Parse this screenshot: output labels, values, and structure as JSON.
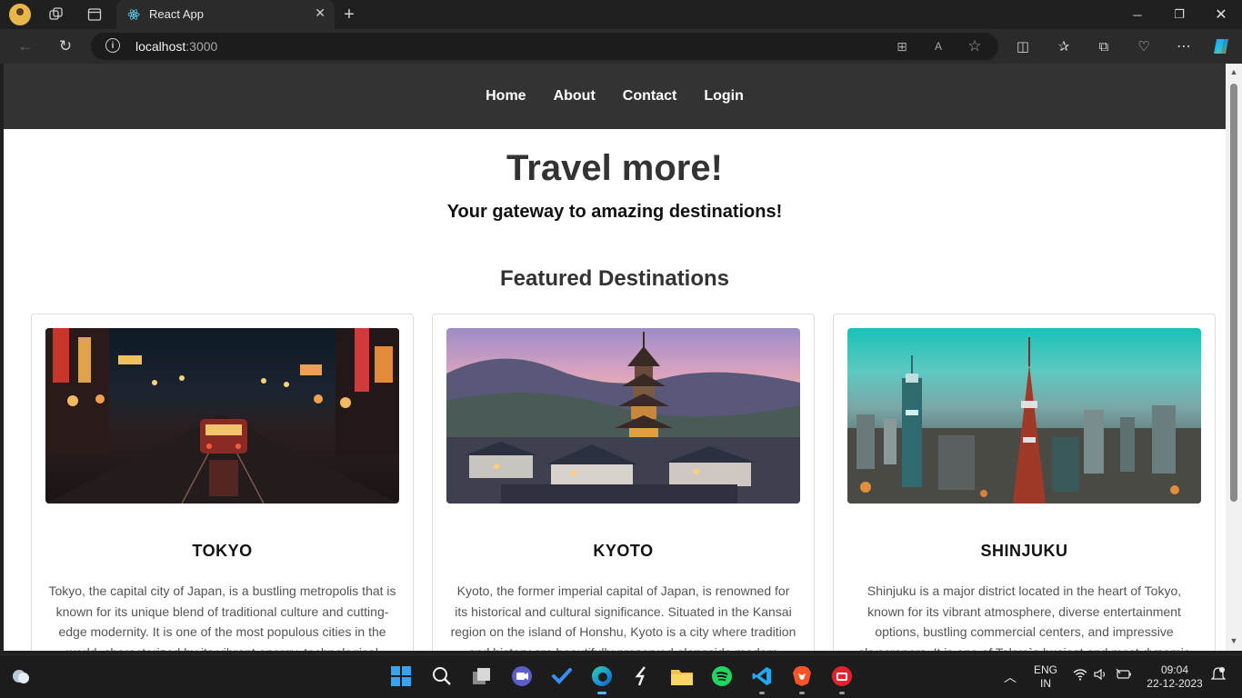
{
  "browser": {
    "tab_title": "React App",
    "url_host": "localhost",
    "url_port": ":3000",
    "icons": [
      "profile-avatar",
      "workspaces-icon",
      "tab-actions-icon",
      "react-favicon",
      "close-icon",
      "new-tab-icon",
      "minimize-icon",
      "restore-icon",
      "window-close-icon",
      "back-icon",
      "refresh-icon",
      "site-info-icon",
      "apps-icon",
      "read-aloud-icon",
      "favorite-star-icon",
      "split-screen-icon",
      "favorites-icon",
      "collections-icon",
      "browser-essentials-icon",
      "more-icon",
      "copilot-icon"
    ]
  },
  "site": {
    "nav": [
      "Home",
      "About",
      "Contact",
      "Login"
    ],
    "hero_title": "Travel more!",
    "hero_subtitle": "Your gateway to amazing destinations!",
    "featured_title": "Featured Destinations",
    "destinations": [
      {
        "name": "TOKYO",
        "description": "Tokyo, the capital city of Japan, is a bustling metropolis that is known for its unique blend of traditional culture and cutting-edge modernity. It is one of the most populous cities in the world, characterized by its vibrant energy, technological"
      },
      {
        "name": "KYOTO",
        "description": "Kyoto, the former imperial capital of Japan, is renowned for its historical and cultural significance. Situated in the Kansai region on the island of Honshu, Kyoto is a city where tradition and history are beautifully preserved alongside modern"
      },
      {
        "name": "SHINJUKU",
        "description": "Shinjuku is a major district located in the heart of Tokyo, known for its vibrant atmosphere, diverse entertainment options, bustling commercial centers, and impressive skyscrapers. It is one of Tokyo`s busiest and most dynamic"
      }
    ]
  },
  "taskbar": {
    "apps": [
      "windows-start",
      "search",
      "task-view",
      "meet",
      "todo",
      "edge",
      "terminal-app",
      "file-explorer",
      "spotify",
      "vscode",
      "brave",
      "red-app"
    ],
    "language_line1": "ENG",
    "language_line2": "IN",
    "time": "09:04",
    "date": "22-12-2023"
  },
  "colors": {
    "site_nav_bg": "#333333",
    "title_color": "#333333",
    "desc_color": "#555555",
    "taskbar_bg": "#1c1c1c",
    "accent": "#57b8ff"
  }
}
